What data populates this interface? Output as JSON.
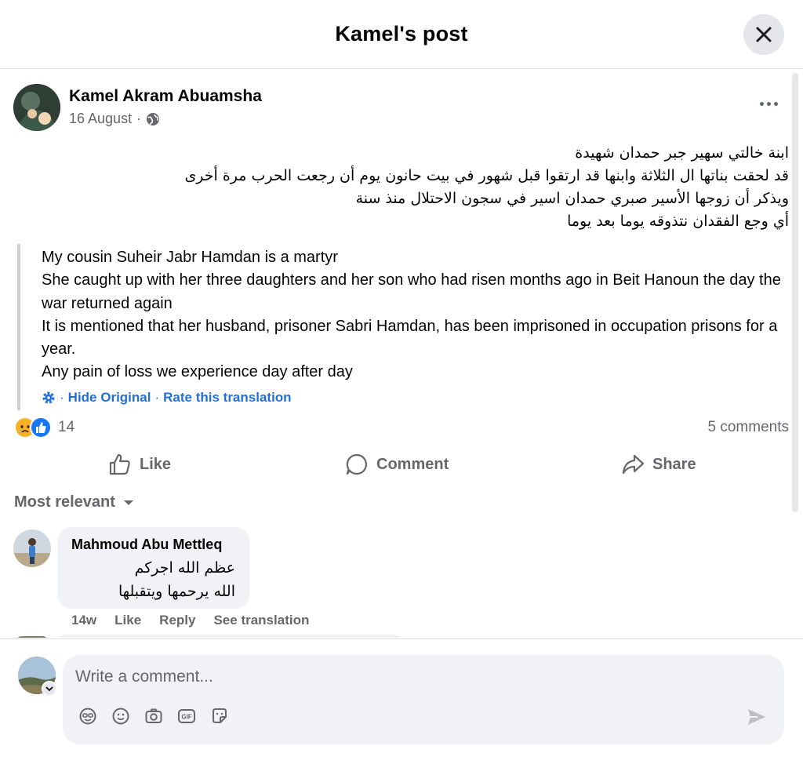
{
  "modal": {
    "title": "Kamel's post"
  },
  "post": {
    "author": "Kamel Akram Abuamsha",
    "date": "16 August",
    "separator": "·",
    "privacy_icon": "globe-icon",
    "arabic_lines": [
      "ابنة خالتي سهير جبر حمدان شهيدة",
      "قد لحقت بناتها ال الثلاثة وابنها قد ارتقوا قبل شهور في بيت حانون يوم أن رجعت الحرب مرة أخرى",
      "ويذكر أن زوجها الأسير صبري حمدان اسير في سجون الاحتلال منذ سنة",
      "أي وجع الفقدان نتذوقه يوما بعد يوما"
    ],
    "translation_lines": [
      "My cousin Suheir Jabr Hamdan is a martyr",
      "She caught up with her three daughters and her son who had risen months ago in Beit Hanoun the day the war returned again",
      "It is mentioned that her husband, prisoner Sabri Hamdan, has been imprisoned in occupation prisons for a year.",
      "Any pain of loss we experience day after day"
    ],
    "translation_links": {
      "hide": "Hide Original",
      "rate": "Rate this translation",
      "dot": "·"
    },
    "reactions": {
      "count": "14",
      "types": [
        "sad-reaction-icon",
        "like-reaction-icon"
      ]
    },
    "comments_count": "5 comments",
    "actions": {
      "like": "Like",
      "comment": "Comment",
      "share": "Share"
    }
  },
  "comments_section": {
    "sort_label": "Most relevant",
    "comments": [
      {
        "author": "Mahmoud Abu Mettleq",
        "lines": [
          "عظم الله اجركم",
          "الله يرحمها ويتقبلها"
        ],
        "age": "14w",
        "like": "Like",
        "reply": "Reply",
        "see_translation": "See translation"
      }
    ]
  },
  "composer": {
    "placeholder": "Write a comment...",
    "tools": [
      "avatar-sticker-icon",
      "emoji-icon",
      "camera-icon",
      "gif-icon",
      "sticker-icon"
    ]
  },
  "colors": {
    "accent": "#216fdb",
    "muted": "#65676b",
    "bubble": "#f0f2f5",
    "like": "#1877f2",
    "sad": "#f7b125"
  }
}
